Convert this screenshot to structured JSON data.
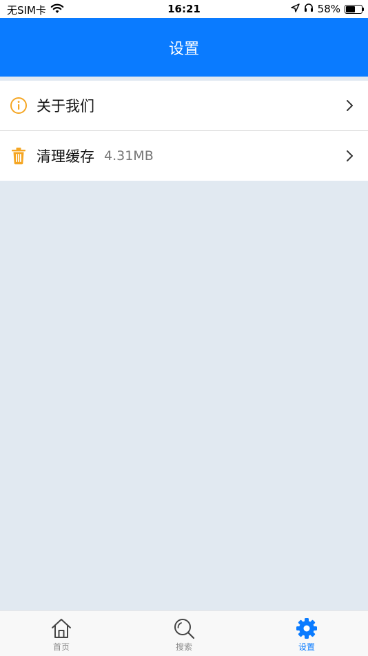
{
  "status_bar": {
    "carrier": "无SIM卡",
    "time": "16:21",
    "battery_text": "58%",
    "battery_level": 58
  },
  "header": {
    "title": "设置"
  },
  "settings": {
    "items": [
      {
        "label": "关于我们",
        "value": "",
        "icon": "info-icon"
      },
      {
        "label": "清理缓存",
        "value": "4.31MB",
        "icon": "trash-icon"
      }
    ]
  },
  "tabbar": {
    "tabs": [
      {
        "label": "首页",
        "icon": "home-icon",
        "active": false
      },
      {
        "label": "搜索",
        "icon": "search-icon",
        "active": false
      },
      {
        "label": "设置",
        "icon": "gear-icon",
        "active": true
      }
    ]
  },
  "colors": {
    "primary": "#0a7bff",
    "icon_accent": "#f5a623",
    "background": "#e1e9f1"
  }
}
